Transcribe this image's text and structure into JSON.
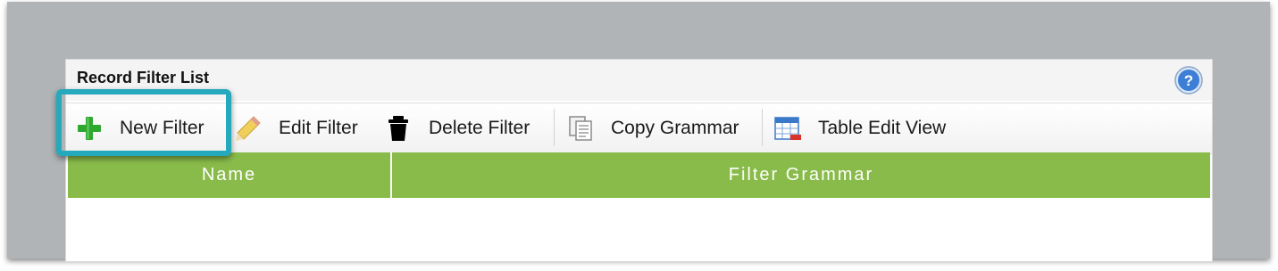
{
  "panel": {
    "title": "Record Filter List"
  },
  "toolbar": {
    "items": [
      {
        "label": "New Filter",
        "icon": "plus-icon",
        "color": "#2ea82e"
      },
      {
        "label": "Edit Filter",
        "icon": "pencil-icon",
        "color": "#e8c34a"
      },
      {
        "label": "Delete Filter",
        "icon": "trash-icon",
        "color": "#000000"
      },
      {
        "label": "Copy Grammar",
        "icon": "copy-icon",
        "color": "#7a7a7a"
      },
      {
        "label": "Table Edit View",
        "icon": "table-icon",
        "color": "#3a78c9"
      }
    ]
  },
  "table": {
    "columns": [
      "Name",
      "Filter Grammar"
    ],
    "rows": []
  },
  "colors": {
    "header_green": "#89bb4a",
    "highlight_teal": "#25a9bd",
    "backdrop_gray": "#b0b4b7",
    "help_blue": "#3d7fd6"
  }
}
